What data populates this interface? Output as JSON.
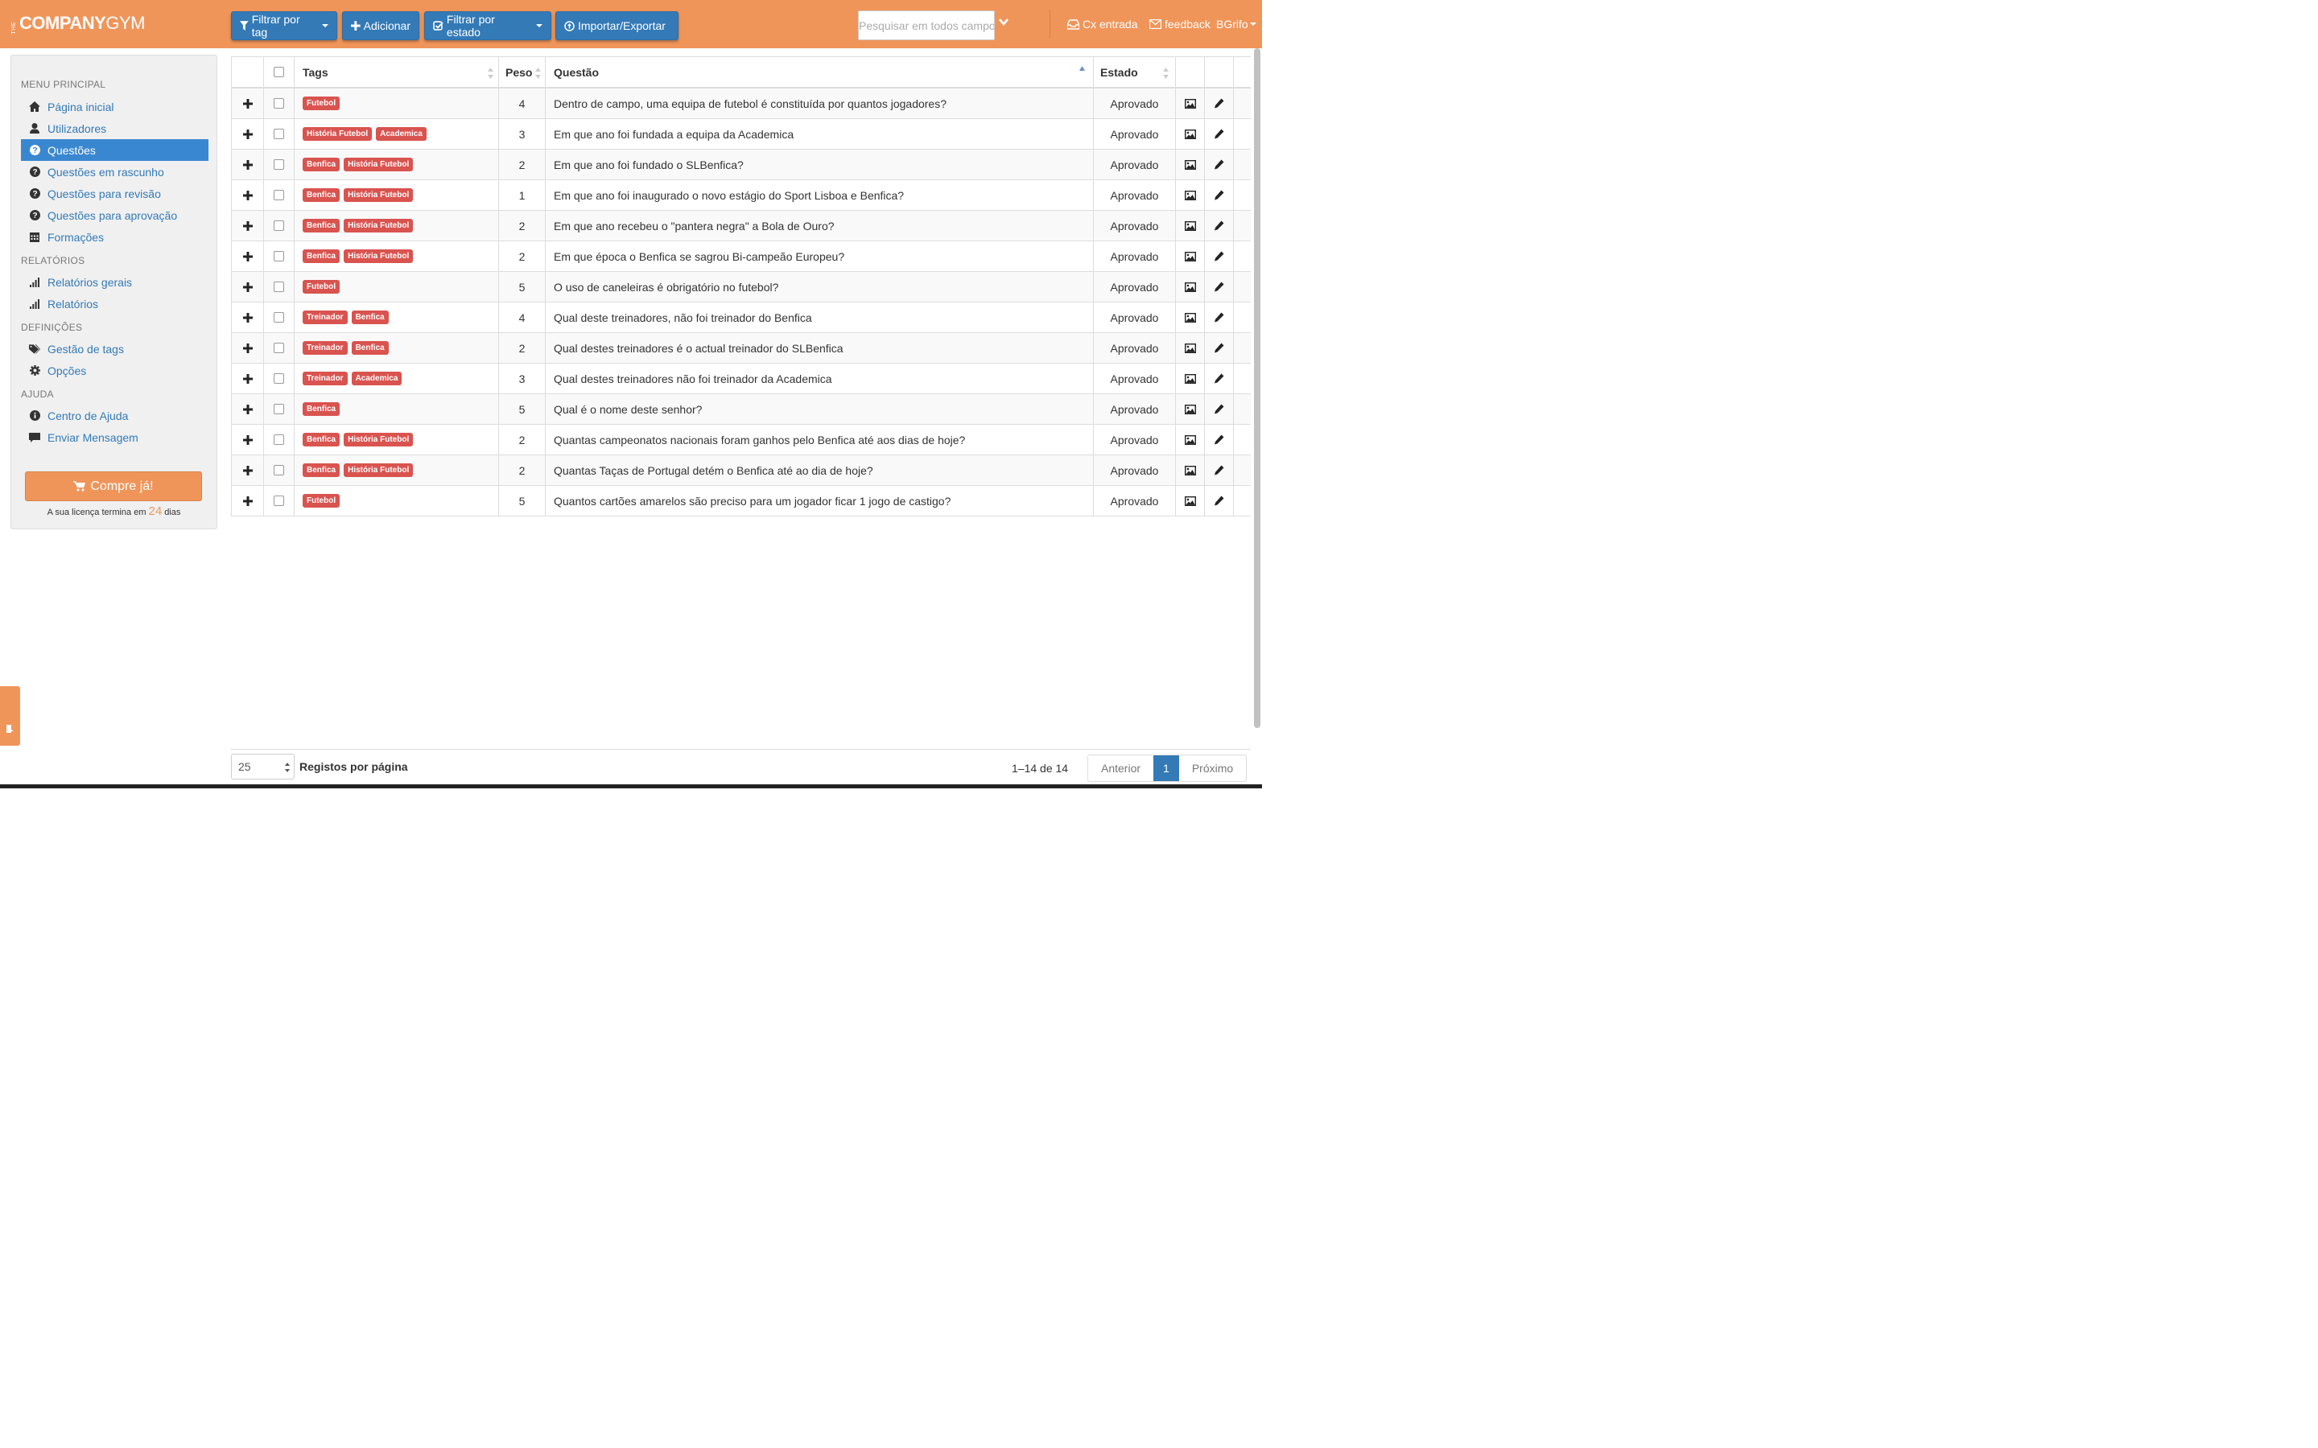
{
  "header": {
    "logo_the": "THE",
    "logo_company": "COMPANY",
    "logo_gym": "GYM",
    "btn_filter_tag": "Filtrar por tag",
    "btn_add": "Adicionar",
    "btn_filter_state": "Filtrar por estado",
    "btn_import": "Importar/Exportar",
    "search_placeholder": "Pesquisar em todos campos",
    "inbox": "Cx entrada",
    "feedback": "feedback",
    "user": "BGrifo"
  },
  "sidebar": {
    "section_main": "MENU PRINCIPAL",
    "items_main": [
      {
        "label": "Página inicial",
        "icon": "home-icon"
      },
      {
        "label": "Utilizadores",
        "icon": "user-icon"
      },
      {
        "label": "Questões",
        "icon": "question-icon",
        "active": true
      },
      {
        "label": "Questões em rascunho",
        "icon": "question-icon"
      },
      {
        "label": "Questões para revisão",
        "icon": "question-icon"
      },
      {
        "label": "Questões para aprovação",
        "icon": "question-icon"
      },
      {
        "label": "Formações",
        "icon": "calendar-icon"
      }
    ],
    "section_reports": "RELATÓRIOS",
    "items_reports": [
      {
        "label": "Relatórios gerais",
        "icon": "signal-icon"
      },
      {
        "label": "Relatórios",
        "icon": "signal-icon"
      }
    ],
    "section_settings": "DEFINIÇÕES",
    "items_settings": [
      {
        "label": "Gestão de tags",
        "icon": "tags-icon"
      },
      {
        "label": "Opções",
        "icon": "gear-icon"
      }
    ],
    "section_help": "AJUDA",
    "items_help": [
      {
        "label": "Centro de Ajuda",
        "icon": "info-icon"
      },
      {
        "label": "Enviar Mensagem",
        "icon": "comment-icon"
      }
    ],
    "buy_button": "Compre já!",
    "license_prefix": "A sua licença termina em",
    "license_days": "24",
    "license_suffix": "dias"
  },
  "table": {
    "headers": {
      "tags": "Tags",
      "weight": "Peso",
      "question": "Questão",
      "state": "Estado"
    },
    "rows": [
      {
        "tags": [
          "Futebol"
        ],
        "weight": "4",
        "question": "Dentro de campo, uma equipa de futebol é constituída por quantos jogadores?",
        "state": "Aprovado"
      },
      {
        "tags": [
          "História Futebol",
          "Academica"
        ],
        "weight": "3",
        "question": "Em que ano foi fundada a equipa da Academica",
        "state": "Aprovado"
      },
      {
        "tags": [
          "Benfica",
          "História Futebol"
        ],
        "weight": "2",
        "question": "Em que ano foi fundado o SLBenfica?",
        "state": "Aprovado"
      },
      {
        "tags": [
          "Benfica",
          "História Futebol"
        ],
        "weight": "1",
        "question": "Em que ano foi inaugurado o novo estágio do Sport Lisboa e Benfica?",
        "state": "Aprovado"
      },
      {
        "tags": [
          "Benfica",
          "História Futebol"
        ],
        "weight": "2",
        "question": "Em que ano recebeu o \"pantera negra\" a Bola de Ouro?",
        "state": "Aprovado"
      },
      {
        "tags": [
          "Benfica",
          "História Futebol"
        ],
        "weight": "2",
        "question": "Em que época o Benfica se sagrou Bi-campeão Europeu?",
        "state": "Aprovado"
      },
      {
        "tags": [
          "Futebol"
        ],
        "weight": "5",
        "question": "O uso de caneleiras é obrigatório no futebol?",
        "state": "Aprovado"
      },
      {
        "tags": [
          "Treinador",
          "Benfica"
        ],
        "weight": "4",
        "question": "Qual deste treinadores, não foi treinador do Benfica",
        "state": "Aprovado"
      },
      {
        "tags": [
          "Treinador",
          "Benfica"
        ],
        "weight": "2",
        "question": "Qual destes treinadores é o actual treinador do SLBenfica",
        "state": "Aprovado"
      },
      {
        "tags": [
          "Treinador",
          "Academica"
        ],
        "weight": "3",
        "question": "Qual destes treinadores não foi treinador da Academica",
        "state": "Aprovado"
      },
      {
        "tags": [
          "Benfica"
        ],
        "weight": "5",
        "question": "Qual é o nome deste senhor?",
        "state": "Aprovado"
      },
      {
        "tags": [
          "Benfica",
          "História Futebol"
        ],
        "weight": "2",
        "question": "Quantas campeonatos nacionais foram ganhos pelo Benfica até aos dias de hoje?",
        "state": "Aprovado"
      },
      {
        "tags": [
          "Benfica",
          "História Futebol"
        ],
        "weight": "2",
        "question": "Quantas Taças de Portugal detém o Benfica até ao dia de hoje?",
        "state": "Aprovado"
      },
      {
        "tags": [
          "Futebol"
        ],
        "weight": "5",
        "question": "Quantos cartões amarelos são preciso para um jogador ficar 1 jogo de castigo?",
        "state": "Aprovado"
      }
    ]
  },
  "footer": {
    "per_page_value": "25",
    "per_page_label": "Registos por página",
    "count": "1–14 de 14",
    "prev": "Anterior",
    "current_page": "1",
    "next": "Próximo"
  },
  "help_tab": "Ajuda",
  "colors": {
    "accent": "#f0955a",
    "primary": "#337ab7",
    "tag": "#d9534f"
  }
}
